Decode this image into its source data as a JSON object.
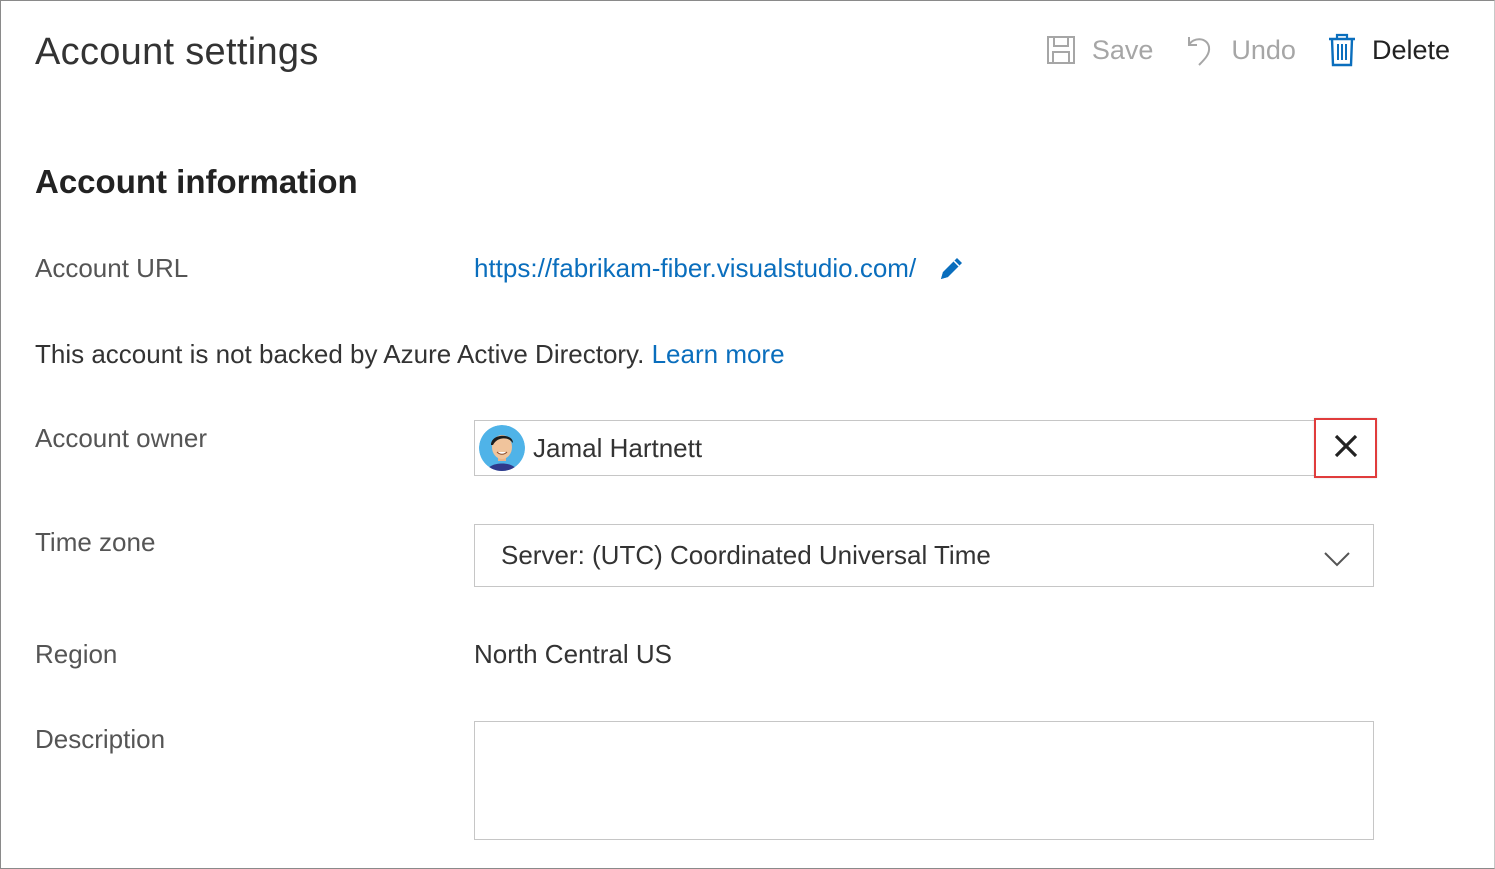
{
  "page": {
    "title": "Account settings"
  },
  "toolbar": {
    "save_label": "Save",
    "undo_label": "Undo",
    "delete_label": "Delete",
    "icons": {
      "save": "save-icon",
      "undo": "undo-icon",
      "delete": "trash-icon"
    }
  },
  "section": {
    "title": "Account information"
  },
  "fields": {
    "account_url": {
      "label": "Account URL",
      "value": "https://fabrikam-fiber.visualstudio.com/"
    },
    "aad_notice": {
      "text": "This account is not backed by Azure Active Directory.",
      "link": "Learn more"
    },
    "account_owner": {
      "label": "Account owner",
      "value": "Jamal Hartnett"
    },
    "time_zone": {
      "label": "Time zone",
      "value": "Server: (UTC) Coordinated Universal Time"
    },
    "region": {
      "label": "Region",
      "value": "North Central US"
    },
    "description": {
      "label": "Description",
      "value": ""
    }
  },
  "colors": {
    "link": "#0a6ebd",
    "highlight": "#e03c3c",
    "disabled": "#a6a6a6"
  }
}
